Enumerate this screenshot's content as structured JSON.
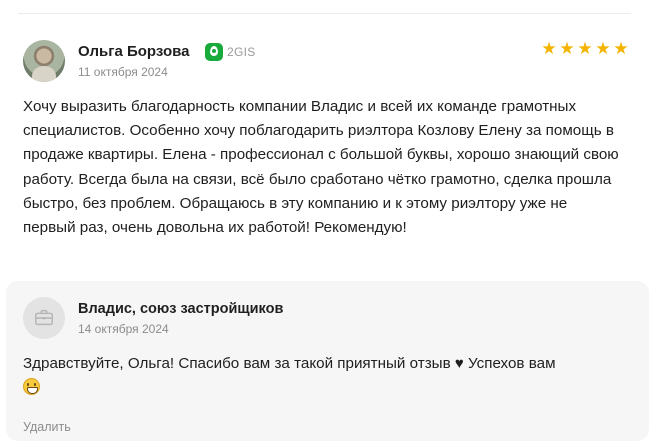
{
  "review": {
    "author_name": "Ольга Борзова",
    "source_label": "2GIS",
    "date": "11 октября 2024",
    "rating": 5,
    "star_glyph": "★",
    "text": "Хочу выразить благодарность компании Владис и всей их команде грамотных специалистов. Особенно хочу поблагодарить риэлтора Козлову Елену за помощь в продаже квартиры. Елена - профессионал с большой буквы, хорошо знающий свою работу. Всегда была на связи, всё было сработано чётко грамотно, сделка прошла быстро, без проблем. Обращаюсь в эту компанию и к этому риэлтору уже не первый раз, очень довольна их работой! Рекомендую!"
  },
  "reply": {
    "org_name": "Владис, союз застройщиков",
    "date": "14 октября 2024",
    "text_main": "Здравствуйте, Ольга! Спасибо вам за такой приятный отзыв",
    "heart": "♥",
    "text_tail": " Успехов вам",
    "delete_label": "Удалить"
  },
  "icons": {
    "author_avatar": "user-photo-avatar",
    "source": "2gis-logo-icon",
    "org_avatar": "briefcase-icon",
    "heart": "heart-icon",
    "emoji": "grinning-face-emoji"
  },
  "colors": {
    "star": "#f4b400",
    "source_icon": "#19aa3c",
    "reply_background": "#f6f6f6",
    "muted_text": "#8c8c8c"
  }
}
